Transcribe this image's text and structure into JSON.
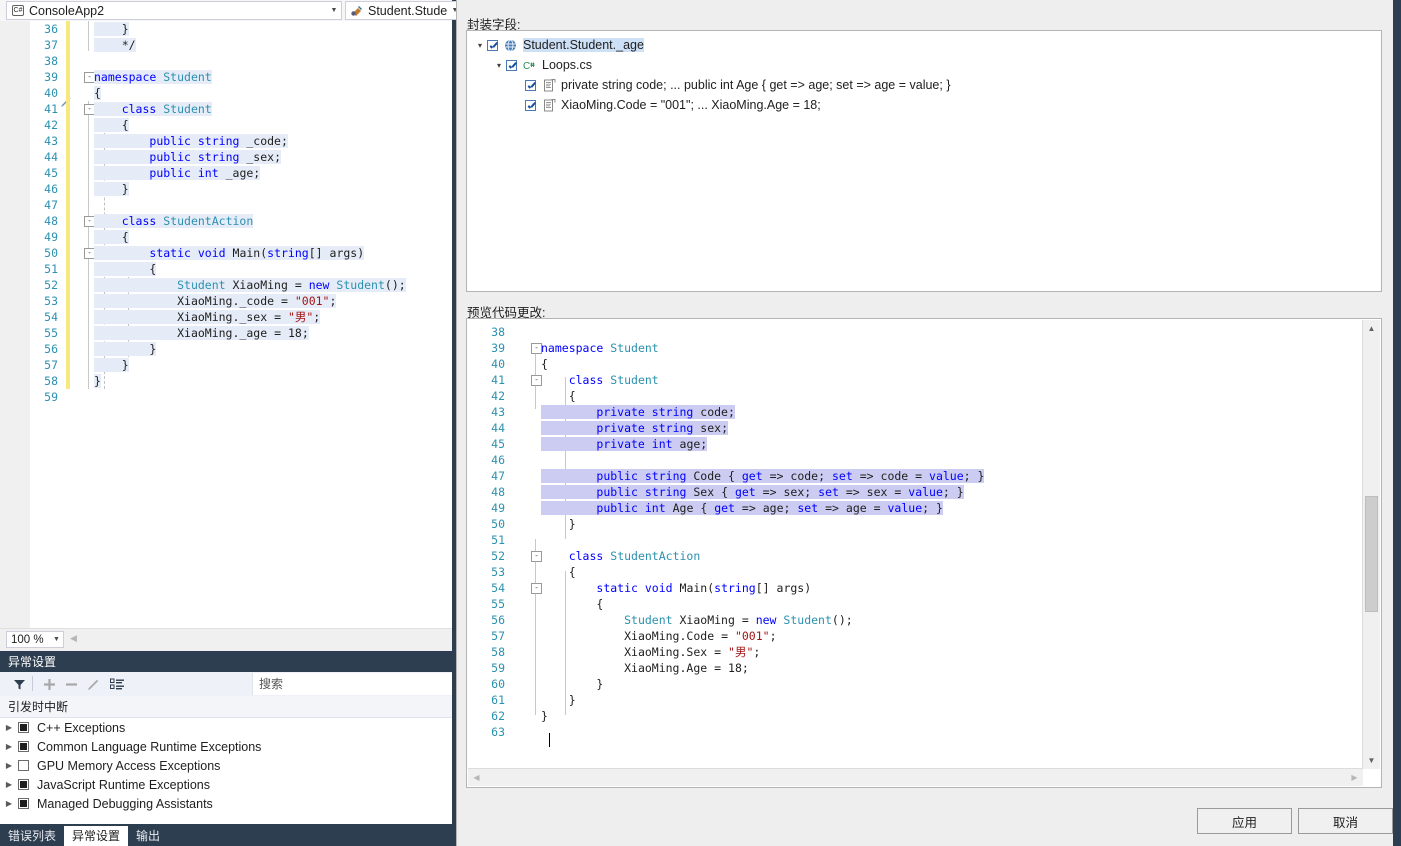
{
  "editor": {
    "nav": {
      "project_label": "ConsoleApp2",
      "project_icon": "csharp-badge-icon",
      "member_label": "Student.Stude",
      "member_icon": "method-icon"
    },
    "zoom_level": "100 %",
    "lines": [
      {
        "num": "36",
        "indent": 0,
        "fold": "",
        "text": "    }",
        "bar": true
      },
      {
        "num": "37",
        "indent": 0,
        "fold": "",
        "text": "    */",
        "bar": true
      },
      {
        "num": "38",
        "indent": 0,
        "fold": "",
        "text": "",
        "bar": true
      },
      {
        "num": "39",
        "indent": 0,
        "fold": "-",
        "text": "namespace Student",
        "bar": true
      },
      {
        "num": "40",
        "indent": 0,
        "fold": "",
        "text": "{",
        "bar": true
      },
      {
        "num": "41",
        "indent": 0,
        "fold": "-",
        "text": "    class Student",
        "bar": true
      },
      {
        "num": "42",
        "indent": 0,
        "fold": "",
        "text": "    {",
        "bar": true
      },
      {
        "num": "43",
        "indent": 0,
        "fold": "",
        "text": "        public string _code;",
        "bar": true
      },
      {
        "num": "44",
        "indent": 0,
        "fold": "",
        "text": "        public string _sex;",
        "bar": true
      },
      {
        "num": "45",
        "indent": 0,
        "fold": "",
        "text": "        public int _age;",
        "bar": true
      },
      {
        "num": "46",
        "indent": 0,
        "fold": "",
        "text": "    }",
        "bar": true
      },
      {
        "num": "47",
        "indent": 0,
        "fold": "",
        "text": "",
        "bar": true
      },
      {
        "num": "48",
        "indent": 0,
        "fold": "-",
        "text": "    class StudentAction",
        "bar": true
      },
      {
        "num": "49",
        "indent": 0,
        "fold": "",
        "text": "    {",
        "bar": true
      },
      {
        "num": "50",
        "indent": 0,
        "fold": "-",
        "text": "        static void Main(string[] args)",
        "bar": true
      },
      {
        "num": "51",
        "indent": 0,
        "fold": "",
        "text": "        {",
        "bar": true
      },
      {
        "num": "52",
        "indent": 0,
        "fold": "",
        "text": "            Student XiaoMing = new Student();",
        "bar": true
      },
      {
        "num": "53",
        "indent": 0,
        "fold": "",
        "text": "            XiaoMing._code = \"001\";",
        "bar": true
      },
      {
        "num": "54",
        "indent": 0,
        "fold": "",
        "text": "            XiaoMing._sex = \"男\";",
        "bar": true
      },
      {
        "num": "55",
        "indent": 0,
        "fold": "",
        "text": "            XiaoMing._age = 18;",
        "bar": true
      },
      {
        "num": "56",
        "indent": 0,
        "fold": "",
        "text": "        }",
        "bar": true
      },
      {
        "num": "57",
        "indent": 0,
        "fold": "",
        "text": "    }",
        "bar": true
      },
      {
        "num": "58",
        "indent": 0,
        "fold": "",
        "text": "}",
        "bar": true
      },
      {
        "num": "59",
        "indent": 0,
        "fold": "",
        "text": "",
        "bar": false
      }
    ]
  },
  "exceptions": {
    "title": "异常设置",
    "search_placeholder": "搜索",
    "column_header": "引发时中断",
    "toolbar": [
      {
        "name": "filter-icon"
      },
      {
        "name": "add-icon"
      },
      {
        "name": "remove-icon"
      },
      {
        "name": "edit-icon"
      },
      {
        "name": "columns-icon"
      }
    ],
    "rows": [
      {
        "label": "C++ Exceptions",
        "checked": true
      },
      {
        "label": "Common Language Runtime Exceptions",
        "checked": true
      },
      {
        "label": "GPU Memory Access Exceptions",
        "checked": false
      },
      {
        "label": "JavaScript Runtime Exceptions",
        "checked": true
      },
      {
        "label": "Managed Debugging Assistants",
        "checked": true
      }
    ],
    "bottom_tabs": [
      {
        "label": "错误列表",
        "active": false
      },
      {
        "label": "异常设置",
        "active": true
      },
      {
        "label": "输出",
        "active": false
      }
    ]
  },
  "dialog": {
    "tree_label": "封装字段:",
    "preview_label": "预览代码更改:",
    "apply_button": "应用",
    "cancel_button": "取消",
    "tree": [
      {
        "depth": 0,
        "arrow": true,
        "checked": true,
        "icon": "globe-icon",
        "label": "Student.Student._age",
        "selected": true
      },
      {
        "depth": 1,
        "arrow": true,
        "checked": true,
        "icon": "csharp-file-icon",
        "label": "Loops.cs",
        "selected": false
      },
      {
        "depth": 2,
        "arrow": false,
        "checked": true,
        "icon": "code-change-icon",
        "label": "private string code; ... public int Age { get => age; set => age = value; }",
        "selected": false
      },
      {
        "depth": 2,
        "arrow": false,
        "checked": true,
        "icon": "code-change-icon",
        "label": "XiaoMing.Code = \"001\"; ... XiaoMing.Age = 18;",
        "selected": false
      }
    ],
    "preview_lines": [
      {
        "num": "38",
        "fold": "",
        "text": "",
        "hl": false
      },
      {
        "num": "39",
        "fold": "-",
        "text": "namespace Student",
        "hl": false
      },
      {
        "num": "40",
        "fold": "",
        "text": "{",
        "hl": false
      },
      {
        "num": "41",
        "fold": "-",
        "text": "    class Student",
        "hl": false
      },
      {
        "num": "42",
        "fold": "",
        "text": "    {",
        "hl": false
      },
      {
        "num": "43",
        "fold": "",
        "text": "        private string code;",
        "hl": true
      },
      {
        "num": "44",
        "fold": "",
        "text": "        private string sex;",
        "hl": true
      },
      {
        "num": "45",
        "fold": "",
        "text": "        private int age;",
        "hl": true
      },
      {
        "num": "46",
        "fold": "",
        "text": "",
        "hl": false
      },
      {
        "num": "47",
        "fold": "",
        "text": "        public string Code { get => code; set => code = value; }",
        "hl": true
      },
      {
        "num": "48",
        "fold": "",
        "text": "        public string Sex { get => sex; set => sex = value; }",
        "hl": true
      },
      {
        "num": "49",
        "fold": "",
        "text": "        public int Age { get => age; set => age = value; }",
        "hl": true
      },
      {
        "num": "50",
        "fold": "",
        "text": "    }",
        "hl": false
      },
      {
        "num": "51",
        "fold": "",
        "text": "",
        "hl": false
      },
      {
        "num": "52",
        "fold": "-",
        "text": "    class StudentAction",
        "hl": false
      },
      {
        "num": "53",
        "fold": "",
        "text": "    {",
        "hl": false
      },
      {
        "num": "54",
        "fold": "-",
        "text": "        static void Main(string[] args)",
        "hl": false
      },
      {
        "num": "55",
        "fold": "",
        "text": "        {",
        "hl": false
      },
      {
        "num": "56",
        "fold": "",
        "text": "            Student XiaoMing = new Student();",
        "hl": false
      },
      {
        "num": "57",
        "fold": "",
        "text": "            XiaoMing.Code = \"001\";",
        "hl": false
      },
      {
        "num": "58",
        "fold": "",
        "text": "            XiaoMing.Sex = \"男\";",
        "hl": false
      },
      {
        "num": "59",
        "fold": "",
        "text": "            XiaoMing.Age = 18;",
        "hl": false
      },
      {
        "num": "60",
        "fold": "",
        "text": "        }",
        "hl": false
      },
      {
        "num": "61",
        "fold": "",
        "text": "    }",
        "hl": false
      },
      {
        "num": "62",
        "fold": "",
        "text": "}",
        "hl": false
      },
      {
        "num": "63",
        "fold": "",
        "text": "",
        "hl": false
      }
    ]
  },
  "colors": {
    "vs_chrome": "#2d3e50",
    "keyword": "#0000ff",
    "type": "#2b91af",
    "string": "#a31515",
    "line_number": "#2b91af",
    "preview_highlight": "#ccccf2",
    "editor_highlight": "#e6ecf7",
    "change_bar": "#f7e97f",
    "dialog_bg": "#efeeee"
  }
}
